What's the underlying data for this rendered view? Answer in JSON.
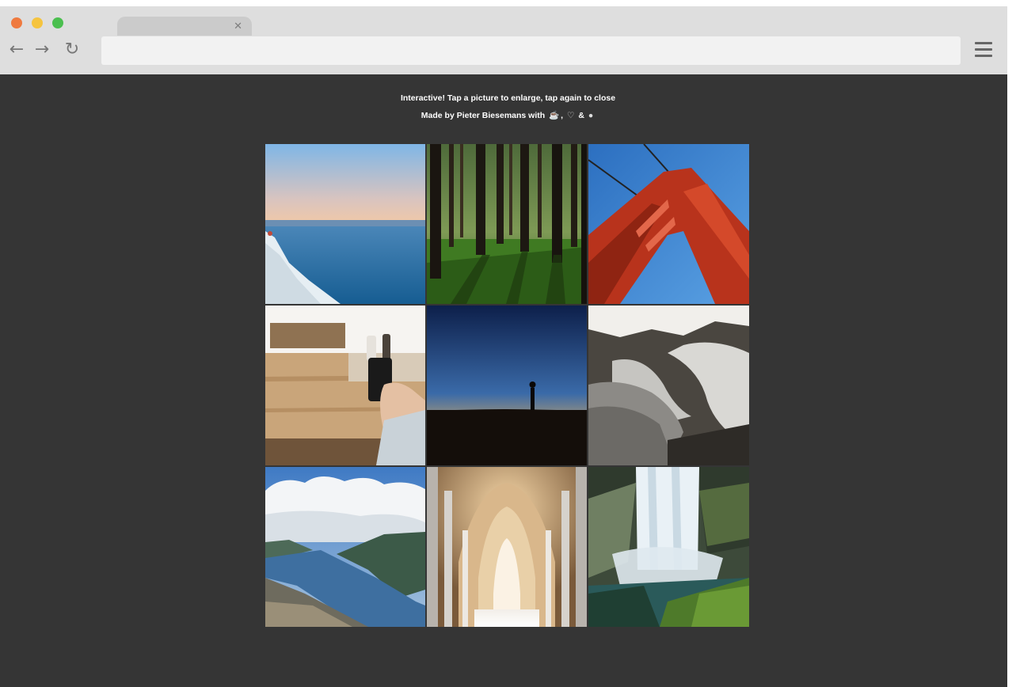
{
  "browser": {
    "tab_close_icon": "close-icon",
    "back_icon": "arrow-left-icon",
    "forward_icon": "arrow-right-icon",
    "reload_icon": "reload-icon",
    "menu_icon": "hamburger-menu-icon",
    "address_value": ""
  },
  "page": {
    "intro": "Interactive! Tap a picture to enlarge, tap again to close",
    "credit_prefix": "Made by Pieter Biesemans with",
    "credit_comma": ",",
    "credit_amp": "&",
    "credit_icons": [
      "coffee-icon",
      "heart-icon",
      "code-icon"
    ]
  },
  "gallery": {
    "tiles": [
      {
        "subject": "sea-ice-horizon"
      },
      {
        "subject": "pine-forest"
      },
      {
        "subject": "red-bridge-tower"
      },
      {
        "subject": "wooden-table-phone"
      },
      {
        "subject": "silhouette-sunset"
      },
      {
        "subject": "steaming-rock-falls"
      },
      {
        "subject": "fjord-clouds"
      },
      {
        "subject": "cathedral-arches"
      },
      {
        "subject": "waterfall-cliff"
      }
    ]
  },
  "colors": {
    "page_background": "#353535",
    "chrome_background": "#dedede",
    "close_dot": "#ef7a3f",
    "minimize_dot": "#f5c43f",
    "maximize_dot": "#4bbf4f"
  }
}
